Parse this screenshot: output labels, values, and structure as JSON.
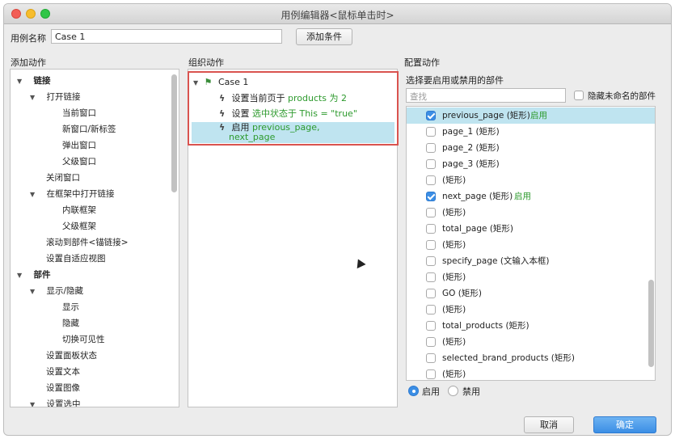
{
  "window": {
    "title": "用例编辑器<鼠标单击时>"
  },
  "case_name": {
    "label": "用例名称",
    "value": "Case 1",
    "add_condition": "添加条件"
  },
  "add_actions": {
    "header": "添加动作",
    "items": [
      {
        "label": "链接",
        "bold": true,
        "expanded": true
      },
      {
        "label": "打开链接",
        "expanded": true
      },
      {
        "label": "当前窗口"
      },
      {
        "label": "新窗口/新标签"
      },
      {
        "label": "弹出窗口"
      },
      {
        "label": "父级窗口"
      },
      {
        "label": "关闭窗口"
      },
      {
        "label": "在框架中打开链接",
        "expanded": true
      },
      {
        "label": "内联框架"
      },
      {
        "label": "父级框架"
      },
      {
        "label": "滚动到部件<锚链接>"
      },
      {
        "label": "设置自适应视图"
      },
      {
        "label": "部件",
        "bold": true,
        "expanded": true
      },
      {
        "label": "显示/隐藏",
        "expanded": true
      },
      {
        "label": "显示"
      },
      {
        "label": "隐藏"
      },
      {
        "label": "切换可见性"
      },
      {
        "label": "设置面板状态"
      },
      {
        "label": "设置文本"
      },
      {
        "label": "设置图像"
      },
      {
        "label": "设置选中",
        "expanded": true
      }
    ]
  },
  "organize": {
    "header": "组织动作",
    "case_label": "Case 1",
    "actions": [
      {
        "prefix": "设置当前页于",
        "detail": "products 为 2"
      },
      {
        "prefix": "设置",
        "detail": "选中状态于 This = \"true\""
      },
      {
        "prefix": "启用",
        "detail": "previous_page,",
        "detail2": "next_page"
      }
    ]
  },
  "configure": {
    "header": "配置动作",
    "subheader": "选择要启用或禁用的部件",
    "search_placeholder": "查找",
    "hide_unnamed": "隐藏未命名的部件",
    "items": [
      {
        "label": "previous_page (矩形)",
        "status": "启用",
        "checked": true
      },
      {
        "label": "page_1 (矩形)"
      },
      {
        "label": "page_2 (矩形)"
      },
      {
        "label": "page_3 (矩形)"
      },
      {
        "label": "(矩形)"
      },
      {
        "label": "next_page (矩形)",
        "status": "启用",
        "checked": true
      },
      {
        "label": "(矩形)"
      },
      {
        "label": "total_page (矩形)"
      },
      {
        "label": "(矩形)"
      },
      {
        "label": "specify_page (文输入本框)"
      },
      {
        "label": "(矩形)"
      },
      {
        "label": "GO (矩形)"
      },
      {
        "label": "(矩形)"
      },
      {
        "label": "total_products (矩形)"
      },
      {
        "label": "(矩形)"
      },
      {
        "label": "selected_brand_products (矩形)"
      },
      {
        "label": "(矩形)"
      }
    ],
    "enable_label": "启用",
    "disable_label": "禁用"
  },
  "footer": {
    "cancel": "取消",
    "ok": "确定"
  },
  "colors": {
    "accent": "#3b8ee5",
    "highlight_row": "#bfe4f0",
    "selection_border": "#d9534f",
    "enabled_text": "#2d9a2d"
  }
}
